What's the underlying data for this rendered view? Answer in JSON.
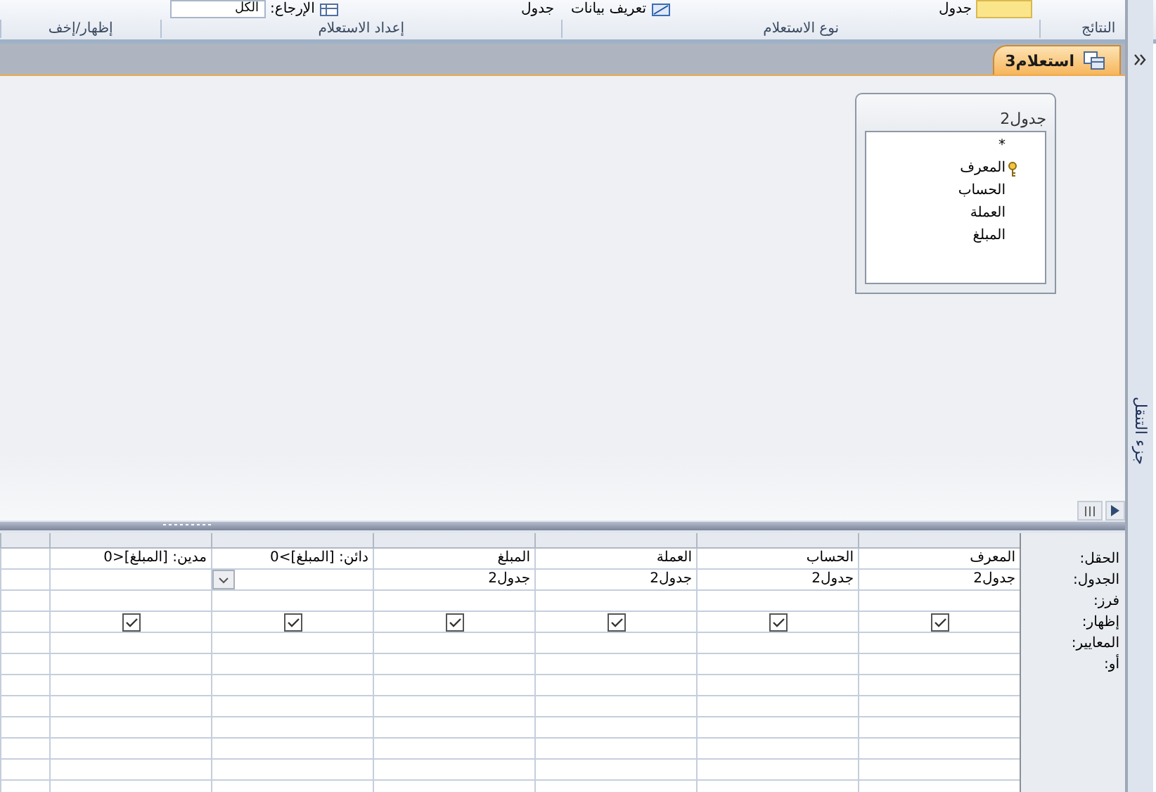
{
  "ribbon": {
    "top_items": [
      {
        "kind": "icon-yellow",
        "text": "جدول"
      },
      {
        "kind": "icon-chart",
        "text": "تعريف بيانات"
      },
      {
        "kind": "plain",
        "text": "جدول"
      },
      {
        "kind": "icon-table",
        "text": "الإرجاع:"
      }
    ],
    "return_field": {
      "value": "الكل"
    },
    "groups": [
      "النتائج",
      "نوع الاستعلام",
      "إعداد الاستعلام",
      "إظهار/إخف"
    ]
  },
  "document_tab": {
    "label": "استعلام3",
    "selected": true
  },
  "table_box": {
    "title": "جدول2",
    "fields": [
      {
        "name": "*",
        "primary_key": false
      },
      {
        "name": "المعرف",
        "primary_key": true
      },
      {
        "name": "الحساب",
        "primary_key": false
      },
      {
        "name": "العملة",
        "primary_key": false
      },
      {
        "name": "المبلغ",
        "primary_key": false
      }
    ]
  },
  "grid": {
    "row_labels": [
      "الحقل:",
      "الجدول:",
      "فرز:",
      "إظهار:",
      "المعايير:",
      "أو:"
    ],
    "columns": [
      {
        "field": "المعرف",
        "table": "جدول2",
        "show": true,
        "active": false
      },
      {
        "field": "الحساب",
        "table": "جدول2",
        "show": true,
        "active": false
      },
      {
        "field": "العملة",
        "table": "جدول2",
        "show": true,
        "active": false
      },
      {
        "field": "المبلغ",
        "table": "جدول2",
        "show": true,
        "active": false
      },
      {
        "field": "دائن: [المبلغ]>0",
        "show": true,
        "active": true
      },
      {
        "field": "مدين: [المبلغ]<0",
        "show": true,
        "active": false
      }
    ]
  },
  "nav_pane": {
    "label": "جزء التنقل"
  }
}
